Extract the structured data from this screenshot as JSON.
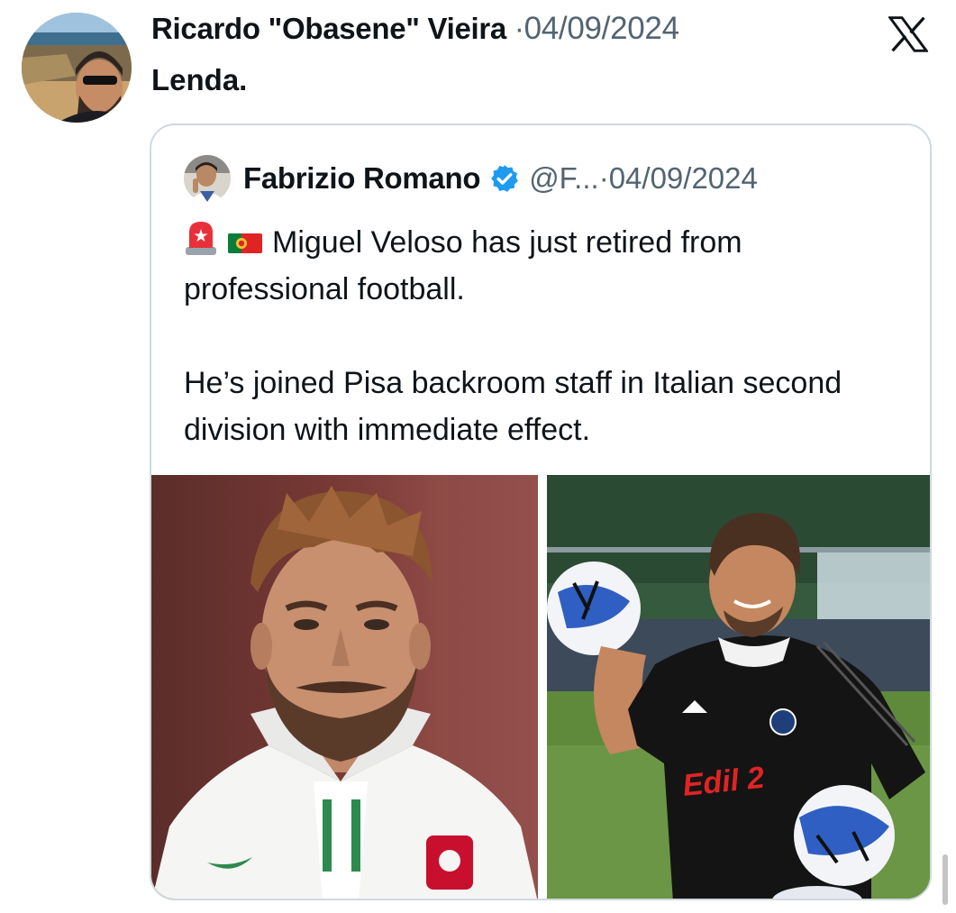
{
  "outer_tweet": {
    "author_name": "Ricardo \"Obasene\" Vieira",
    "separator": "·",
    "date": "04/09/2024",
    "text": "Lenda.",
    "avatar_icon": "user-avatar-photo"
  },
  "brand": {
    "logo": "x-logo-icon"
  },
  "quoted_tweet": {
    "author_name": "Fabrizio Romano",
    "verified": true,
    "handle": "@F...",
    "separator": "·",
    "date": "04/09/2024",
    "paragraph_1_emojis": [
      "siren-emoji",
      "portugal-flag-emoji"
    ],
    "paragraph_1": "Miguel Veloso has just retired from professional football.",
    "paragraph_2": "He’s joined Pisa backroom staff in Italian second division with immediate effect.",
    "images": [
      {
        "icon": "player-portrait-photo"
      },
      {
        "icon": "training-photo"
      }
    ],
    "image_2_kit_text": "Edil 2"
  },
  "colors": {
    "text": "#0f1419",
    "secondary": "#536471",
    "verified": "#1d9bf0",
    "border": "#cfd9de"
  }
}
